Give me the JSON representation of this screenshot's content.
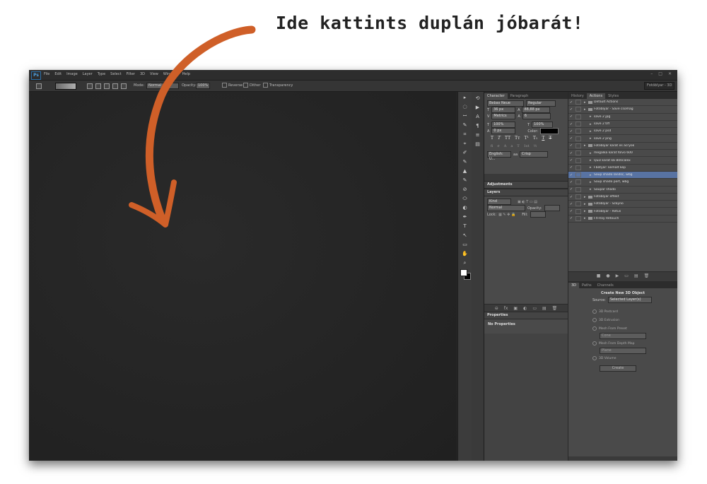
{
  "headline": "Ide kattints duplán jóbarát!",
  "app": {
    "logo": "Ps",
    "menu": [
      "File",
      "Edit",
      "Image",
      "Layer",
      "Type",
      "Select",
      "Filter",
      "3D",
      "View",
      "Window",
      "Help"
    ],
    "window_controls": [
      "–",
      "□",
      "✕"
    ],
    "workspace": "Fotóblyar - 3D"
  },
  "options_bar": {
    "mode_label": "Mode:",
    "mode_value": "Normal",
    "opacity_label": "Opacity:",
    "opacity_value": "100%",
    "reverse_label": "Reverse",
    "dither_label": "Dither",
    "transparency_label": "Transparency"
  },
  "tools": [
    "▸",
    "◌",
    "ꟷ",
    "✎",
    "⌗",
    "⌖",
    "✐",
    "✎",
    "▲",
    "✎",
    "⊘",
    "⬭",
    "◐",
    "✒",
    "T",
    "↖",
    "▭",
    "✋",
    "⌕"
  ],
  "character_panel": {
    "tabs": [
      "Character",
      "Paragraph"
    ],
    "font_family": "Bebas Neue",
    "font_style": "Regular",
    "font_size": "36 px",
    "leading": "88,88 px",
    "kerning": "Metrics",
    "tracking": "6",
    "vertical_scale": "100%",
    "horizontal_scale": "100%",
    "baseline_shift": "0 px",
    "color_label": "Color:",
    "language": "English: U...",
    "aa_label": "aa",
    "antialias": "Crisp"
  },
  "adjustments_panel": {
    "title": "Adjustments"
  },
  "layers_panel": {
    "title": "Layers",
    "kind": "Kind",
    "blend": "Normal",
    "opacity_label": "Opacity:",
    "lock_label": "Lock:",
    "fill_label": "Fill:"
  },
  "properties_panel": {
    "title": "Properties",
    "body": "No Properties"
  },
  "actions_panel": {
    "tabs": [
      "History",
      "Actions",
      "Styles"
    ],
    "rows": [
      {
        "name": "Default Actions",
        "folder": true,
        "indent": 0,
        "checked": true
      },
      {
        "name": "Fotóblyar - Save csomag",
        "folder": true,
        "indent": 0,
        "checked": true
      },
      {
        "name": "save 2 jpg",
        "folder": false,
        "indent": 1,
        "checked": true
      },
      {
        "name": "save 2 tiff",
        "folder": false,
        "indent": 1,
        "checked": true
      },
      {
        "name": "save 2 psd",
        "folder": false,
        "indent": 1,
        "checked": true
      },
      {
        "name": "save 2 png",
        "folder": false,
        "indent": 1,
        "checked": true
      },
      {
        "name": "Fotóblyar karat es acryok",
        "folder": true,
        "indent": 0,
        "checked": true
      },
      {
        "name": "megalka karat folvo 600",
        "folder": false,
        "indent": 1,
        "checked": true
      },
      {
        "name": "Quiz karat kb 800calex",
        "folder": false,
        "indent": 1,
        "checked": true
      },
      {
        "name": "Fbótyar: kemalt kep",
        "folder": false,
        "indent": 1,
        "checked": true
      },
      {
        "name": "Saup shado landsc, wbg",
        "folder": false,
        "indent": 1,
        "checked": true,
        "selected": true
      },
      {
        "name": "Saup shado port, wbg",
        "folder": false,
        "indent": 1,
        "checked": true
      },
      {
        "name": "Saupar shado",
        "folder": false,
        "indent": 1,
        "checked": true
      },
      {
        "name": "Fotóblyar effekt",
        "folder": true,
        "indent": 0,
        "checked": true
      },
      {
        "name": "Fotóblyar - Szayno",
        "folder": true,
        "indent": 0,
        "checked": true
      },
      {
        "name": "Fotóblyar - Retus",
        "folder": true,
        "indent": 0,
        "checked": true
      },
      {
        "name": "FX-Ray Retouch",
        "folder": true,
        "indent": 0,
        "checked": true
      }
    ],
    "footer_icons": [
      "■",
      "●",
      "▶",
      "▭",
      "▤",
      "🗑"
    ]
  },
  "threed_panel": {
    "tabs": [
      "3D",
      "Paths",
      "Channels"
    ],
    "title": "Create New 3D Object",
    "source_label": "Source:",
    "source_value": "Selected Layer(s)",
    "options": [
      "3D Postcard",
      "3D Extrusion",
      "Mesh From Preset",
      "Mesh From Depth Map",
      "3D Volume"
    ],
    "preset_value": "Cone",
    "depth_value": "Plane",
    "create_button": "Create"
  },
  "colors": {
    "arrow": "#cf5f28",
    "selection": "#5873a3"
  }
}
